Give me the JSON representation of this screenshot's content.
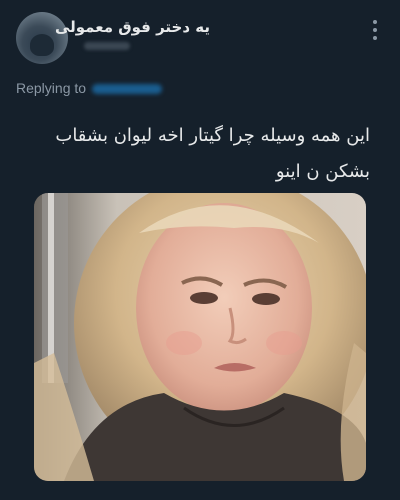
{
  "tweet": {
    "display_name": "یه دختر فوق معمولی",
    "replying_label": "Replying to",
    "text_lines": [
      "این همه وسیله چرا گیتار اخه لیوان بشقاب",
      "بشکن ن اینو"
    ]
  },
  "icons": {
    "more": "vertical-ellipsis-icon"
  },
  "colors": {
    "background": "#15202b",
    "primary_text": "#e7e9ea",
    "secondary_text": "#8b98a5",
    "link": "#1d9bf0"
  }
}
